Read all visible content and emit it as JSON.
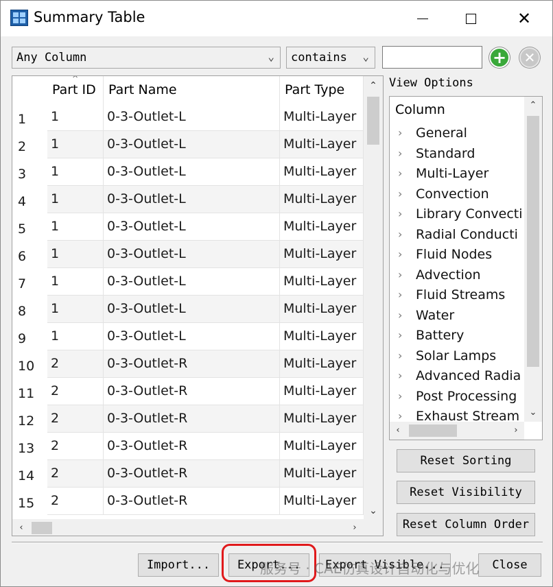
{
  "window": {
    "title": "Summary Table"
  },
  "filter": {
    "column_selected": "Any Column",
    "operator_selected": "contains",
    "value": ""
  },
  "table": {
    "columns": [
      "Part ID",
      "Part Name",
      "Part Type"
    ],
    "rows": [
      {
        "n": "1",
        "id": "1",
        "name": "0-3-Outlet-L",
        "type": "Multi-Layer"
      },
      {
        "n": "2",
        "id": "1",
        "name": "0-3-Outlet-L",
        "type": "Multi-Layer"
      },
      {
        "n": "3",
        "id": "1",
        "name": "0-3-Outlet-L",
        "type": "Multi-Layer"
      },
      {
        "n": "4",
        "id": "1",
        "name": "0-3-Outlet-L",
        "type": "Multi-Layer"
      },
      {
        "n": "5",
        "id": "1",
        "name": "0-3-Outlet-L",
        "type": "Multi-Layer"
      },
      {
        "n": "6",
        "id": "1",
        "name": "0-3-Outlet-L",
        "type": "Multi-Layer"
      },
      {
        "n": "7",
        "id": "1",
        "name": "0-3-Outlet-L",
        "type": "Multi-Layer"
      },
      {
        "n": "8",
        "id": "1",
        "name": "0-3-Outlet-L",
        "type": "Multi-Layer"
      },
      {
        "n": "9",
        "id": "1",
        "name": "0-3-Outlet-L",
        "type": "Multi-Layer"
      },
      {
        "n": "10",
        "id": "2",
        "name": "0-3-Outlet-R",
        "type": "Multi-Layer"
      },
      {
        "n": "11",
        "id": "2",
        "name": "0-3-Outlet-R",
        "type": "Multi-Layer"
      },
      {
        "n": "12",
        "id": "2",
        "name": "0-3-Outlet-R",
        "type": "Multi-Layer"
      },
      {
        "n": "13",
        "id": "2",
        "name": "0-3-Outlet-R",
        "type": "Multi-Layer"
      },
      {
        "n": "14",
        "id": "2",
        "name": "0-3-Outlet-R",
        "type": "Multi-Layer"
      },
      {
        "n": "15",
        "id": "2",
        "name": "0-3-Outlet-R",
        "type": "Multi-Layer"
      }
    ]
  },
  "view_options": {
    "label": "View Options",
    "header": "Column",
    "items": [
      "General",
      "Standard",
      "Multi-Layer",
      "Convection",
      "Library Convecti",
      "Radial Conducti",
      "Fluid Nodes",
      "Advection",
      "Fluid Streams",
      "Water",
      "Battery",
      "Solar Lamps",
      "Advanced Radia",
      "Post Processing",
      "Exhaust Stream"
    ]
  },
  "buttons": {
    "reset_sorting": "Reset Sorting",
    "reset_visibility": "Reset Visibility",
    "reset_column_order": "Reset Column Order",
    "import": "Import...",
    "export": "Export...",
    "export_visible": "Export Visible...",
    "close": "Close"
  },
  "watermark": "服务号 · CAE仿真设计自动化与优化",
  "colors": {
    "highlight": "#e0191b",
    "add": "#3aa83a",
    "title_icon": "#1e5fa8"
  }
}
